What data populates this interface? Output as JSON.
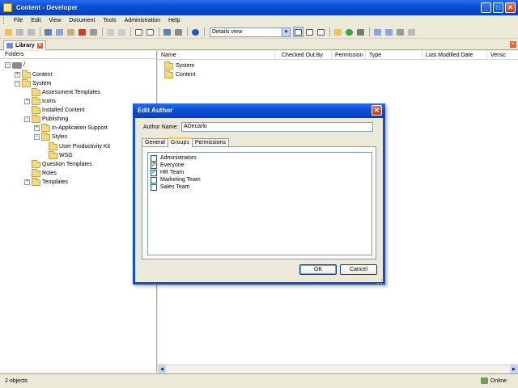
{
  "window": {
    "title": "Content - Developer",
    "buttons": {
      "minimize": "_",
      "maximize": "□",
      "close": "✕"
    }
  },
  "menubar": {
    "items": [
      "File",
      "Edit",
      "View",
      "Document",
      "Tools",
      "Administration",
      "Help"
    ]
  },
  "toolbar": {
    "view_select": "Details view"
  },
  "library_tab": {
    "label": "Library"
  },
  "folders_pane": {
    "header": "Folders",
    "tree": [
      {
        "label": "/",
        "expander": "−"
      },
      {
        "label": "Content",
        "expander": "+"
      },
      {
        "label": "System",
        "expander": "−"
      },
      {
        "label": "Assessment Templates",
        "expander": ""
      },
      {
        "label": "Icons",
        "expander": "+"
      },
      {
        "label": "Installed Content",
        "expander": ""
      },
      {
        "label": "Publishing",
        "expander": "−"
      },
      {
        "label": "In-Application Support",
        "expander": "+"
      },
      {
        "label": "Styles",
        "expander": "−"
      },
      {
        "label": "User Productivity Kit",
        "expander": ""
      },
      {
        "label": "WSG",
        "expander": ""
      },
      {
        "label": "Question Templates",
        "expander": ""
      },
      {
        "label": "Roles",
        "expander": ""
      },
      {
        "label": "Templates",
        "expander": "+"
      }
    ]
  },
  "list_pane": {
    "columns": [
      "Name",
      "Checked Out By",
      "Permission",
      "Type",
      "Last Modified Date",
      "Versic"
    ],
    "rows": [
      "System",
      "Content"
    ]
  },
  "statusbar": {
    "count": "2 objects",
    "connection": "Online"
  },
  "dialog": {
    "title": "Edit Author",
    "author_name_label": "Author Name:",
    "author_name_value": "ADecarlo",
    "tabs": [
      "General",
      "Groups",
      "Permissions"
    ],
    "active_tab": "Groups",
    "groups": [
      {
        "label": "Administrators",
        "checked": false
      },
      {
        "label": "Everyone",
        "checked": true
      },
      {
        "label": "HR Team",
        "checked": true
      },
      {
        "label": "Marketing Team",
        "checked": false
      },
      {
        "label": "Sales Team",
        "checked": false
      }
    ],
    "ok_label": "OK",
    "cancel_label": "Cancel"
  }
}
